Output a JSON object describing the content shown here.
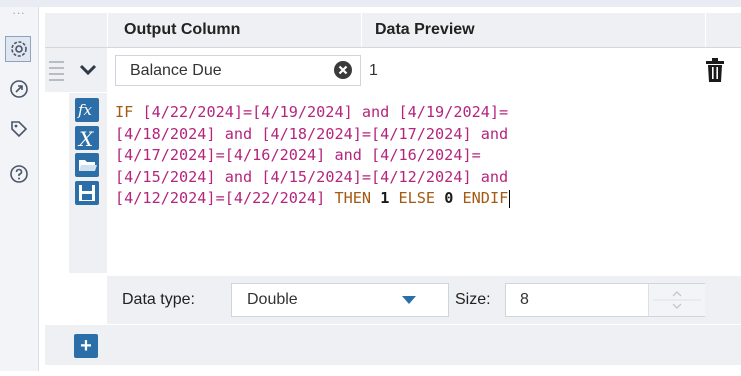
{
  "colors": {
    "accent": "#2c6fa8",
    "datetime": "#b5247d",
    "keyword": "#a35a12"
  },
  "toolbar": {
    "more_glyph": "...",
    "icons": [
      "gear-icon",
      "arrow-circle-icon",
      "tag-icon",
      "help-icon"
    ]
  },
  "grid": {
    "header_output_column": "Output Column",
    "header_data_preview": "Data Preview"
  },
  "row": {
    "column_name": "Balance Due",
    "preview_value": "1"
  },
  "expression": {
    "line1": {
      "a": "IF ",
      "b": "[4/22/2024]=[4/19/2024]",
      "c": " and ",
      "d": "[4/19/2024]="
    },
    "line2": {
      "a": "[4/18/2024]",
      "b": " and ",
      "c": "[4/18/2024]=[4/17/2024]",
      "d": " and"
    },
    "line3": {
      "a": "[4/17/2024]=[4/16/2024]",
      "b": " and ",
      "c": "[4/16/2024]="
    },
    "line4": {
      "a": "[4/15/2024]",
      "b": " and ",
      "c": "[4/15/2024]=[4/12/2024]",
      "d": " and"
    },
    "line5": {
      "a": "[4/12/2024]=[4/22/2024]",
      "b": " THEN ",
      "c": "1",
      "d": " ELSE ",
      "e": "0",
      "f": " ENDIF"
    },
    "side_buttons": [
      "fx-icon",
      "variable-x-icon",
      "open-folder-icon",
      "save-icon"
    ]
  },
  "type_row": {
    "type_label": "Data type:",
    "type_value": "Double",
    "size_label": "Size:",
    "size_value": "8"
  },
  "add_button": "+"
}
